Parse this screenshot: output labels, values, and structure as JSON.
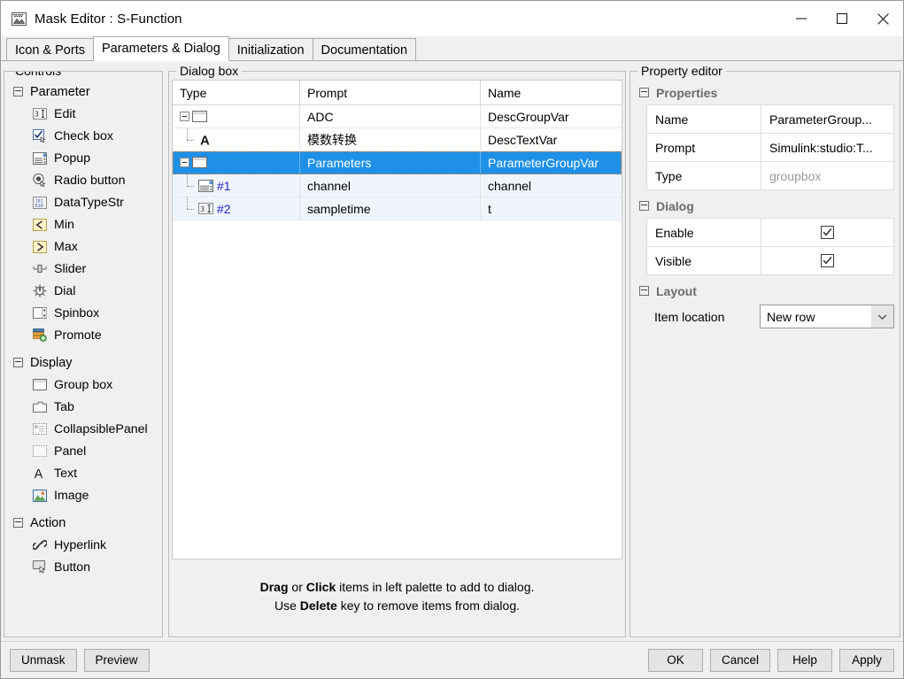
{
  "window": {
    "title": "Mask Editor : S-Function",
    "icon": "mask-editor-icon",
    "minimize_label": "Minimize",
    "maximize_label": "Maximize",
    "close_label": "Close"
  },
  "tabs": [
    {
      "label": "Icon & Ports",
      "active": false
    },
    {
      "label": "Parameters & Dialog",
      "active": true
    },
    {
      "label": "Initialization",
      "active": false
    },
    {
      "label": "Documentation",
      "active": false
    }
  ],
  "palette": {
    "title": "Controls",
    "sections": [
      {
        "label": "Parameter",
        "items": [
          {
            "label": "Edit",
            "icon": "edit-field-icon"
          },
          {
            "label": "Check box",
            "icon": "checkbox-icon"
          },
          {
            "label": "Popup",
            "icon": "popup-list-icon"
          },
          {
            "label": "Radio button",
            "icon": "radio-button-icon"
          },
          {
            "label": "DataTypeStr",
            "icon": "datatype-icon"
          },
          {
            "label": "Min",
            "icon": "min-less-than-icon"
          },
          {
            "label": "Max",
            "icon": "max-greater-than-icon"
          },
          {
            "label": "Slider",
            "icon": "slider-icon"
          },
          {
            "label": "Dial",
            "icon": "dial-icon"
          },
          {
            "label": "Spinbox",
            "icon": "spinbox-icon"
          },
          {
            "label": "Promote",
            "icon": "promote-icon"
          }
        ]
      },
      {
        "label": "Display",
        "items": [
          {
            "label": "Group box",
            "icon": "group-box-icon"
          },
          {
            "label": "Tab",
            "icon": "tab-folder-icon"
          },
          {
            "label": "CollapsiblePanel",
            "icon": "collapsible-panel-icon"
          },
          {
            "label": "Panel",
            "icon": "panel-icon"
          },
          {
            "label": "Text",
            "icon": "text-a-icon"
          },
          {
            "label": "Image",
            "icon": "image-icon"
          }
        ]
      },
      {
        "label": "Action",
        "items": [
          {
            "label": "Hyperlink",
            "icon": "hyperlink-icon"
          },
          {
            "label": "Button",
            "icon": "button-icon"
          }
        ]
      }
    ]
  },
  "dialog_box": {
    "title": "Dialog box",
    "columns": [
      "Type",
      "Prompt",
      "Name"
    ],
    "rows": [
      {
        "icon": "group-box-icon",
        "type_text": "",
        "prompt": "ADC",
        "name": "DescGroupVar",
        "indent": 0,
        "expander": true,
        "selected": false,
        "alt": false
      },
      {
        "icon": "text-a-icon",
        "type_text": "",
        "prompt": "模数转换",
        "name": "DescTextVar",
        "indent": 1,
        "expander": false,
        "selected": false,
        "alt": false
      },
      {
        "icon": "group-box-icon",
        "type_text": "",
        "prompt": "Parameters",
        "name": "ParameterGroupVar",
        "indent": 0,
        "expander": true,
        "selected": true,
        "alt": false
      },
      {
        "icon": "popup-list-icon",
        "type_text": "#1",
        "prompt": "channel",
        "name": "channel",
        "indent": 1,
        "expander": false,
        "selected": false,
        "alt": true
      },
      {
        "icon": "edit-field-icon",
        "type_text": "#2",
        "prompt": "sampletime",
        "name": "t",
        "indent": 1,
        "expander": false,
        "selected": false,
        "alt": true
      }
    ],
    "hint_line1_pre": "",
    "hint_line1_bold1": "Drag",
    "hint_line1_mid": " or ",
    "hint_line1_bold2": "Click",
    "hint_line1_post": " items in left palette to add to dialog.",
    "hint_line2_pre": "Use ",
    "hint_line2_bold": "Delete",
    "hint_line2_post": " key to remove items from dialog."
  },
  "property_editor": {
    "title": "Property editor",
    "sections": {
      "properties": {
        "label": "Properties",
        "rows": [
          {
            "key": "Name",
            "value": "ParameterGroup...",
            "readonly": false
          },
          {
            "key": "Prompt",
            "value": "Simulink:studio:T...",
            "readonly": false
          },
          {
            "key": "Type",
            "value": "groupbox",
            "readonly": true
          }
        ]
      },
      "dialog": {
        "label": "Dialog",
        "rows": [
          {
            "key": "Enable",
            "checked": true
          },
          {
            "key": "Visible",
            "checked": true
          }
        ]
      },
      "layout": {
        "label": "Layout",
        "key": "Item location",
        "value": "New row"
      }
    }
  },
  "buttons": {
    "left": [
      "Unmask",
      "Preview"
    ],
    "right": [
      "OK",
      "Cancel",
      "Help",
      "Apply"
    ]
  },
  "colors": {
    "selection_blue": "#1e90e8",
    "alt_row": "#f0f5fc",
    "focus_orange": "#e08a30",
    "window_bg": "#f0f0f0",
    "number_blue": "#2222cc"
  }
}
